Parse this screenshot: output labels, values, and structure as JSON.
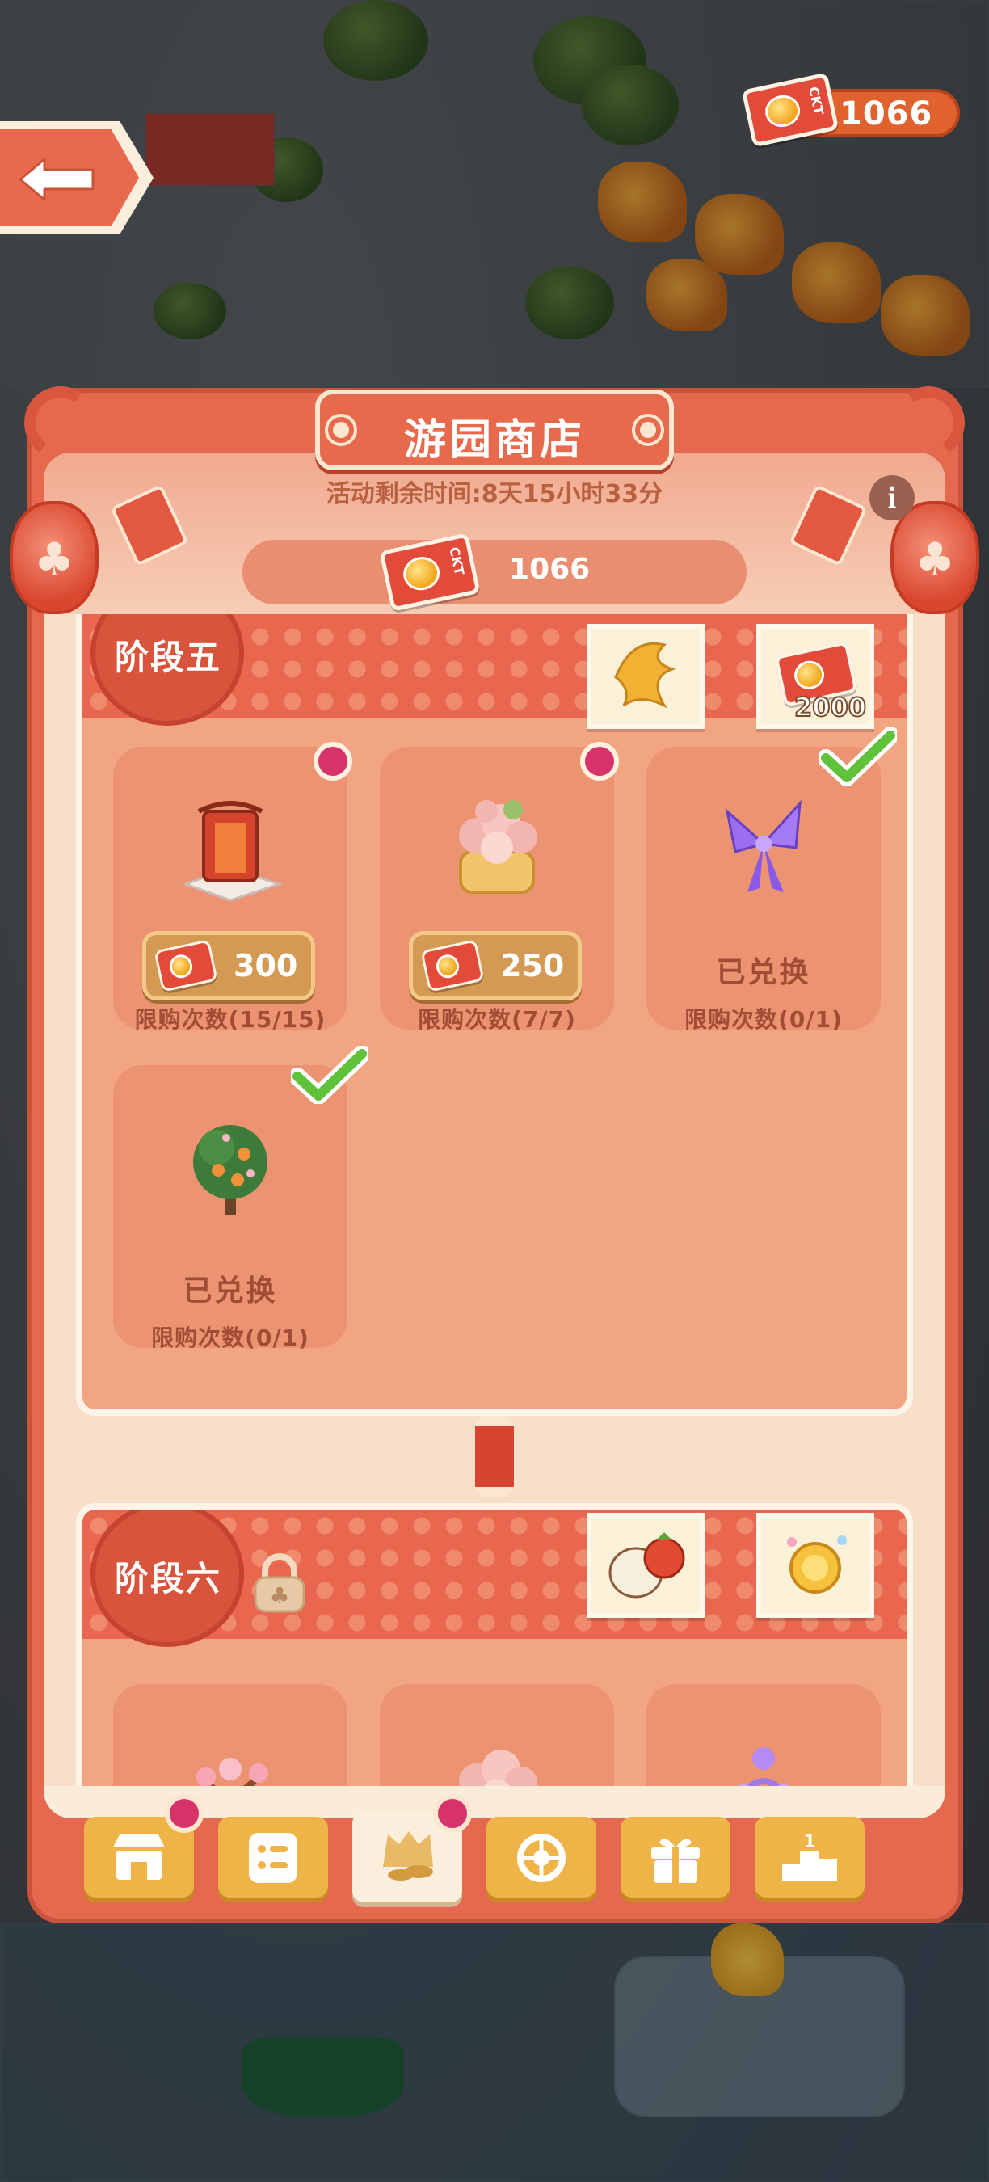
{
  "header": {
    "title": "游园商店",
    "timer_text": "活动剩余时间:8天15小时33分",
    "currency_amount": "1066",
    "top_currency_amount": "1066",
    "ticket_label": "CKT"
  },
  "stages": [
    {
      "name": "阶段五",
      "locked": false,
      "rewards": [
        {
          "icon": "golden-phoenix-icon",
          "amount": ""
        },
        {
          "icon": "ticket-icon",
          "amount": "2000"
        }
      ],
      "items": [
        {
          "icon": "red-gate-decoration-icon",
          "price": "300",
          "limit": "限购次数(15/15)",
          "redeemed": false,
          "badge": true
        },
        {
          "icon": "flower-cake-icon",
          "price": "250",
          "limit": "限购次数(7/7)",
          "redeemed": false,
          "badge": true
        },
        {
          "icon": "purple-bow-icon",
          "status": "已兑换",
          "limit": "限购次数(0/1)",
          "redeemed": true
        },
        {
          "icon": "fruit-tree-icon",
          "status": "已兑换",
          "limit": "限购次数(0/1)",
          "redeemed": true
        }
      ]
    },
    {
      "name": "阶段六",
      "locked": true,
      "rewards": [
        {
          "icon": "horse-lantern-icon",
          "amount": ""
        },
        {
          "icon": "golden-coin-icon",
          "amount": ""
        }
      ],
      "items": [
        {
          "icon": "blossom-tree-icon"
        },
        {
          "icon": "flower-cake-icon"
        },
        {
          "icon": "flower-basket-icon"
        }
      ]
    }
  ],
  "tabs": [
    {
      "icon": "shop-icon",
      "badge": true,
      "active": false
    },
    {
      "icon": "task-list-icon",
      "badge": false,
      "active": false
    },
    {
      "icon": "exchange-shop-icon",
      "badge": true,
      "active": true
    },
    {
      "icon": "lucky-wheel-icon",
      "badge": false,
      "active": false
    },
    {
      "icon": "gift-icon",
      "badge": false,
      "active": false
    },
    {
      "icon": "ranking-icon",
      "badge": false,
      "active": false
    }
  ],
  "colors": {
    "panel": "#e5694e",
    "panel_inner": "#fbebd9",
    "card": "#ec9471",
    "badge_dot": "#d6336b",
    "tab": "#efb447",
    "text_brown": "#a14d35"
  }
}
